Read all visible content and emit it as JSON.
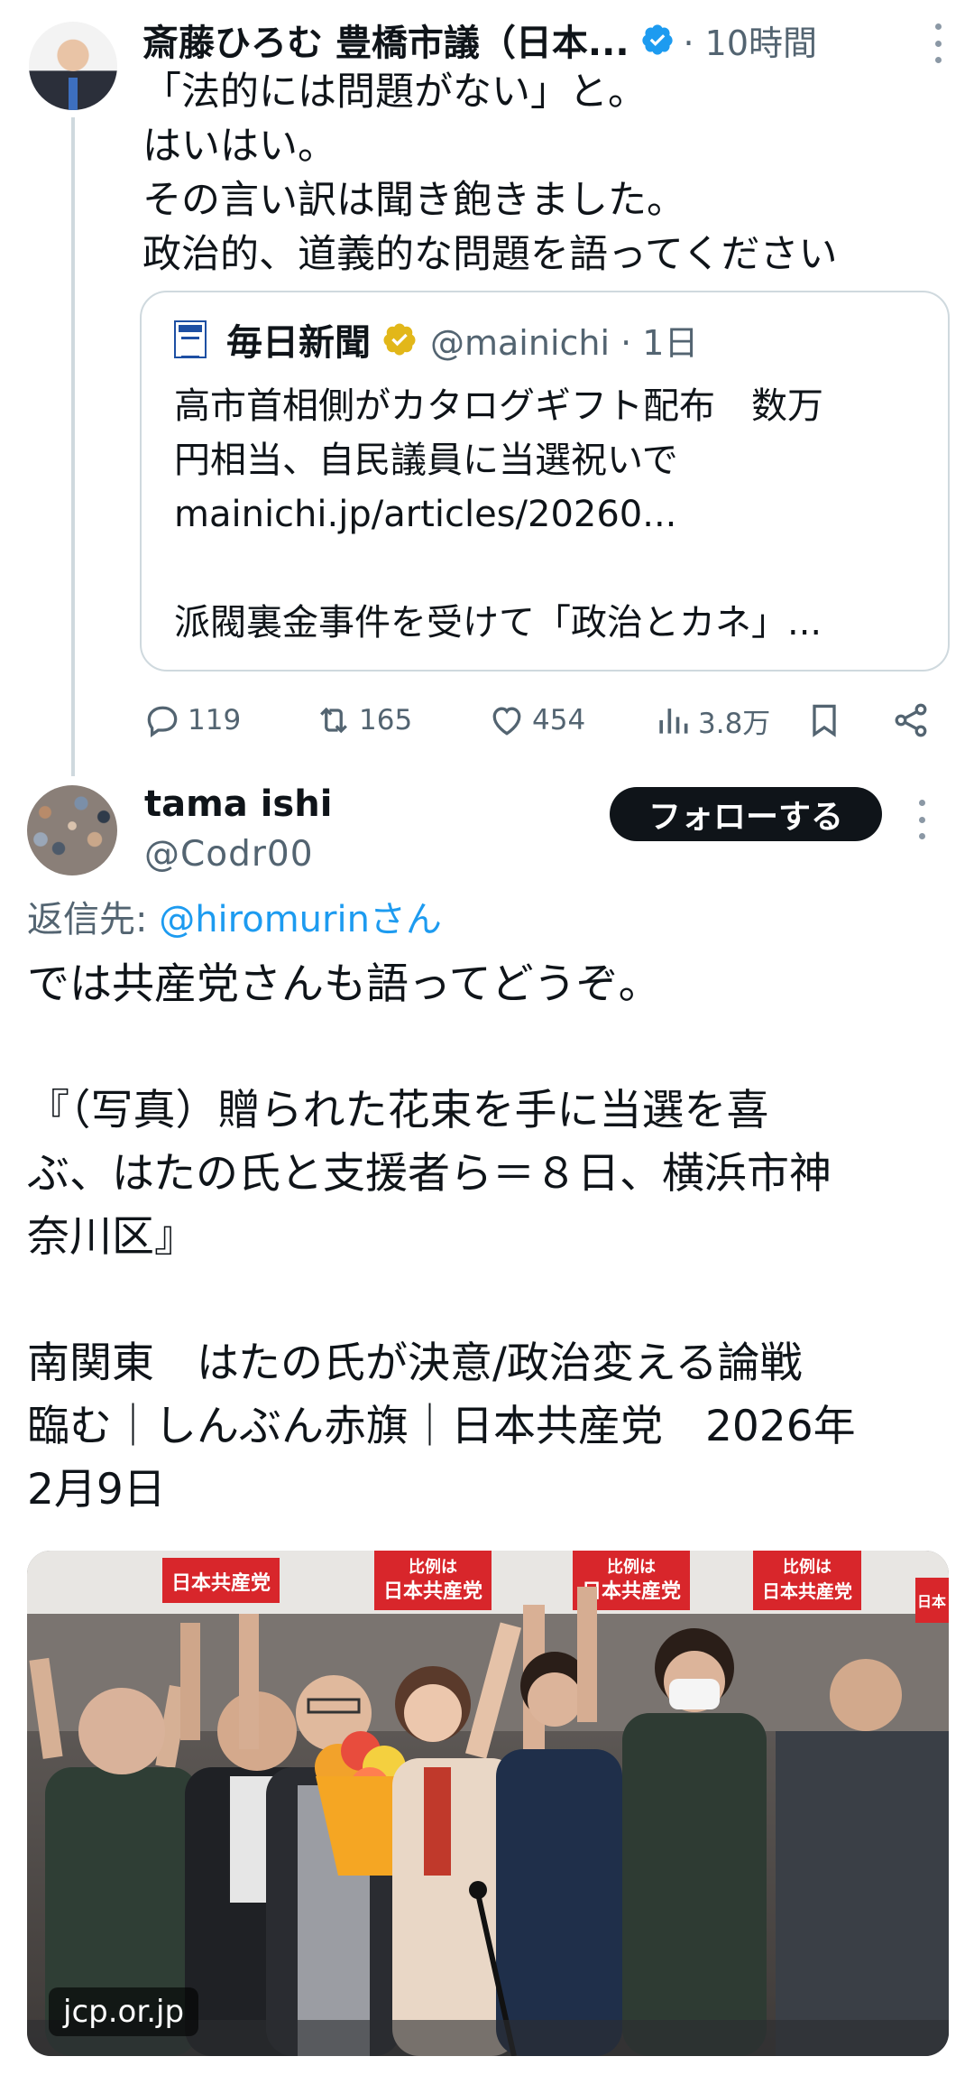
{
  "tweet1": {
    "author_name": "斎藤ひろむ 豊橋市議（日本...",
    "time": "· 10時間",
    "lines": [
      "「法的には問題がない」と。",
      "はいはい。",
      "その言い訳は聞き飽きました。",
      "政治的、道義的な問題を語ってください"
    ],
    "quote": {
      "author_name": "毎日新聞",
      "handle_time": "@mainichi · 1日",
      "lines": [
        "高市首相側がカタログギフト配布　数万",
        "円相当、自民議員に当選祝いで",
        "mainichi.jp/articles/20260...",
        "",
        "派閥裏金事件を受けて「政治とカネ」..."
      ]
    },
    "actions": {
      "replies": "119",
      "reposts": "165",
      "likes": "454",
      "views": "3.8万"
    }
  },
  "tweet2": {
    "author_name": "tama ishi",
    "handle": "@Codr00",
    "follow_label": "フォローする",
    "reply_prefix": "返信先: ",
    "reply_mention": "@hiromurinさん",
    "lines": [
      "では共産党さんも語ってどうぞ。",
      "",
      "『（写真）贈られた花束を手に当選を喜",
      "ぶ、はたの氏と支援者ら＝８日、横浜市神",
      "奈川区』",
      "",
      " 南関東　はたの氏が決意/政治変える論戦",
      "臨む｜しんぶん赤旗｜日本共産党　2026年",
      "2月9日"
    ],
    "photo": {
      "domain": "jcp.or.jp",
      "banner_1": "日本共産党",
      "banner_2_top": "比例は",
      "banner_2_bottom": "日本共産党",
      "banner_3_top": "比例は",
      "banner_3_bottom": "日本共産党",
      "banner_4_top": "比例は",
      "banner_4_bottom": "日本共産党",
      "banner_5": "日本"
    }
  },
  "colors": {
    "text": "#0f1419",
    "secondary": "#536471",
    "link": "#1d9bf0",
    "verified_blue": "#1d9bf0",
    "verified_gold": "#e2b719",
    "banner_red": "#d8262b"
  }
}
